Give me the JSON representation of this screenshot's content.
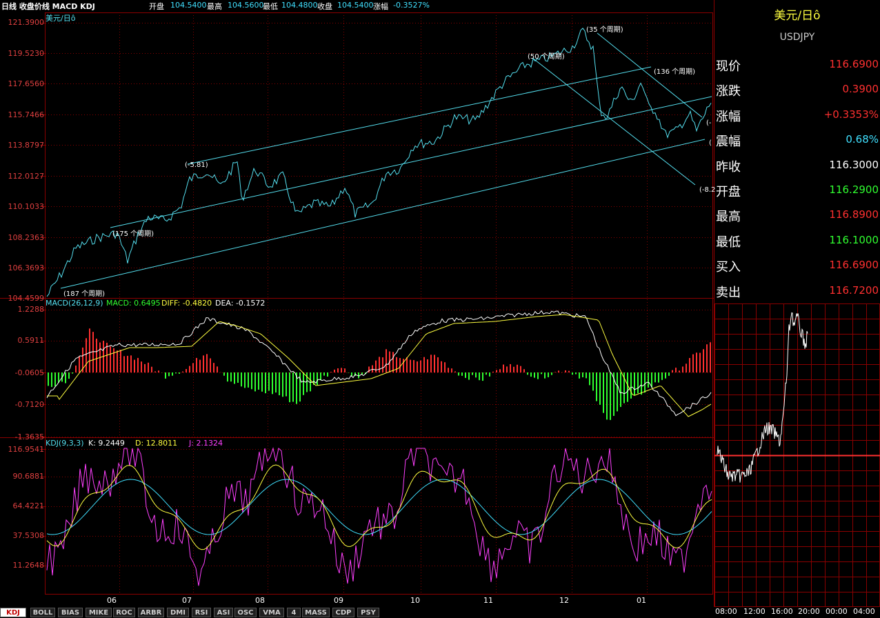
{
  "header": {
    "title": "日线 收盘价线 MACD KDJ",
    "open_label": "开盘",
    "open": "104.5400",
    "high_label": "最高",
    "high": "104.5600",
    "low_label": "最低",
    "low": "104.4800",
    "close_label": "收盘",
    "close": "104.5400",
    "chg_label": "涨幅",
    "chg": "-0.3527%"
  },
  "colors": {
    "grid": "#8b0000",
    "price": "#55e0f0",
    "up": "#ff3030",
    "down": "#30ff30",
    "dif": "#ffffff",
    "dea": "#ffff40",
    "k": "#ffffff",
    "d": "#ffff40",
    "j": "#ff40ff"
  },
  "main_chart": {
    "symbol_label": "美元/日ô",
    "y_ticks": [
      "121.3900",
      "119.5230",
      "117.6560",
      "115.7466",
      "113.8797",
      "112.0127",
      "110.1033",
      "108.2363",
      "106.3693",
      "104.4599"
    ],
    "x_ticks": [
      "06",
      "07",
      "08",
      "09",
      "10",
      "11",
      "12",
      "01"
    ],
    "annotations": [
      "(-5.81)",
      "(175 个周期)",
      "(187 个周期)",
      "(50 个周期)",
      "(35 个周期)",
      "(136 个周期)",
      "(-8.2",
      "(-",
      "("
    ]
  },
  "macd_panel": {
    "name": "MACD(26,12,9)",
    "macd_label": "MACD: 0.6495",
    "diff_label": "DIFF: -0.4820",
    "dea_label": "DEA: -0.1572",
    "y_ticks": [
      "1.2288",
      "0.5911",
      "-0.0605",
      "-0.7120",
      "-1.3635"
    ]
  },
  "kdj_panel": {
    "name": "KDJ(9,3,3)",
    "k_label": "K: 9.2449",
    "d_label": "D: 12.8011",
    "j_label": "J: 2.1324",
    "y_ticks": [
      "116.9541",
      "90.6881",
      "64.4221",
      "37.5308",
      "11.2648"
    ]
  },
  "quote": {
    "title": "美元/日ô",
    "code": "USDJPY",
    "rows": [
      {
        "label": "现价",
        "value": "116.6900",
        "color": "#ff3030"
      },
      {
        "label": "涨跌",
        "value": "0.3900",
        "color": "#ff3030"
      },
      {
        "label": "涨幅",
        "value": "+0.3353%",
        "color": "#ff3030"
      },
      {
        "label": "震幅",
        "value": "0.68%",
        "color": "#40e0ff"
      },
      {
        "label": "昨收",
        "value": "116.3000",
        "color": "#ffffff"
      },
      {
        "label": "开盘",
        "value": "116.2900",
        "color": "#30ff30"
      },
      {
        "label": "最高",
        "value": "116.8900",
        "color": "#ff3030"
      },
      {
        "label": "最低",
        "value": "116.1000",
        "color": "#30ff30"
      },
      {
        "label": "买入",
        "value": "116.6900",
        "color": "#ff3030"
      },
      {
        "label": "卖出",
        "value": "116.7200",
        "color": "#ff3030"
      }
    ],
    "time_ticks": [
      "08:00",
      "12:00",
      "16:00",
      "20:00",
      "00:00",
      "04:00"
    ]
  },
  "tabs": [
    "KDJ",
    "BOLL",
    "BIAS",
    "MIKE",
    "ROC",
    "ARBR",
    "DMI",
    "RSI",
    "ASI",
    "OSC",
    "VMA",
    "4",
    "MASS",
    "CDP",
    "PSY"
  ]
}
